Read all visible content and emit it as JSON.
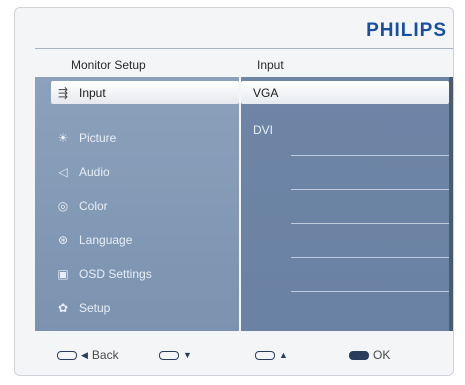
{
  "brand": "PHILIPS",
  "header": {
    "left_title": "Monitor Setup",
    "right_title": "Input"
  },
  "menu": {
    "items": [
      {
        "label": "Input",
        "icon": "input-icon",
        "glyph": "⇶"
      },
      {
        "label": "Picture",
        "icon": "picture-icon",
        "glyph": "☀"
      },
      {
        "label": "Audio",
        "icon": "audio-icon",
        "glyph": "◁"
      },
      {
        "label": "Color",
        "icon": "color-icon",
        "glyph": "◎"
      },
      {
        "label": "Language",
        "icon": "language-icon",
        "glyph": "⊛"
      },
      {
        "label": "OSD Settings",
        "icon": "osd-settings-icon",
        "glyph": "▣"
      },
      {
        "label": "Setup",
        "icon": "setup-icon",
        "glyph": "✿"
      }
    ],
    "selected_index": 0
  },
  "options": {
    "items": [
      "VGA",
      "DVI"
    ],
    "selected_index": 0
  },
  "footer": {
    "back": {
      "arrow": "◀",
      "label": "Back"
    },
    "down": {
      "arrow": "▼",
      "label": ""
    },
    "up": {
      "arrow": "▲",
      "label": ""
    },
    "ok": {
      "label": "OK"
    }
  },
  "colors": {
    "brand": "#1a4ea0",
    "left_panel": "#8ca1bb",
    "right_panel": "#6e85a6"
  }
}
